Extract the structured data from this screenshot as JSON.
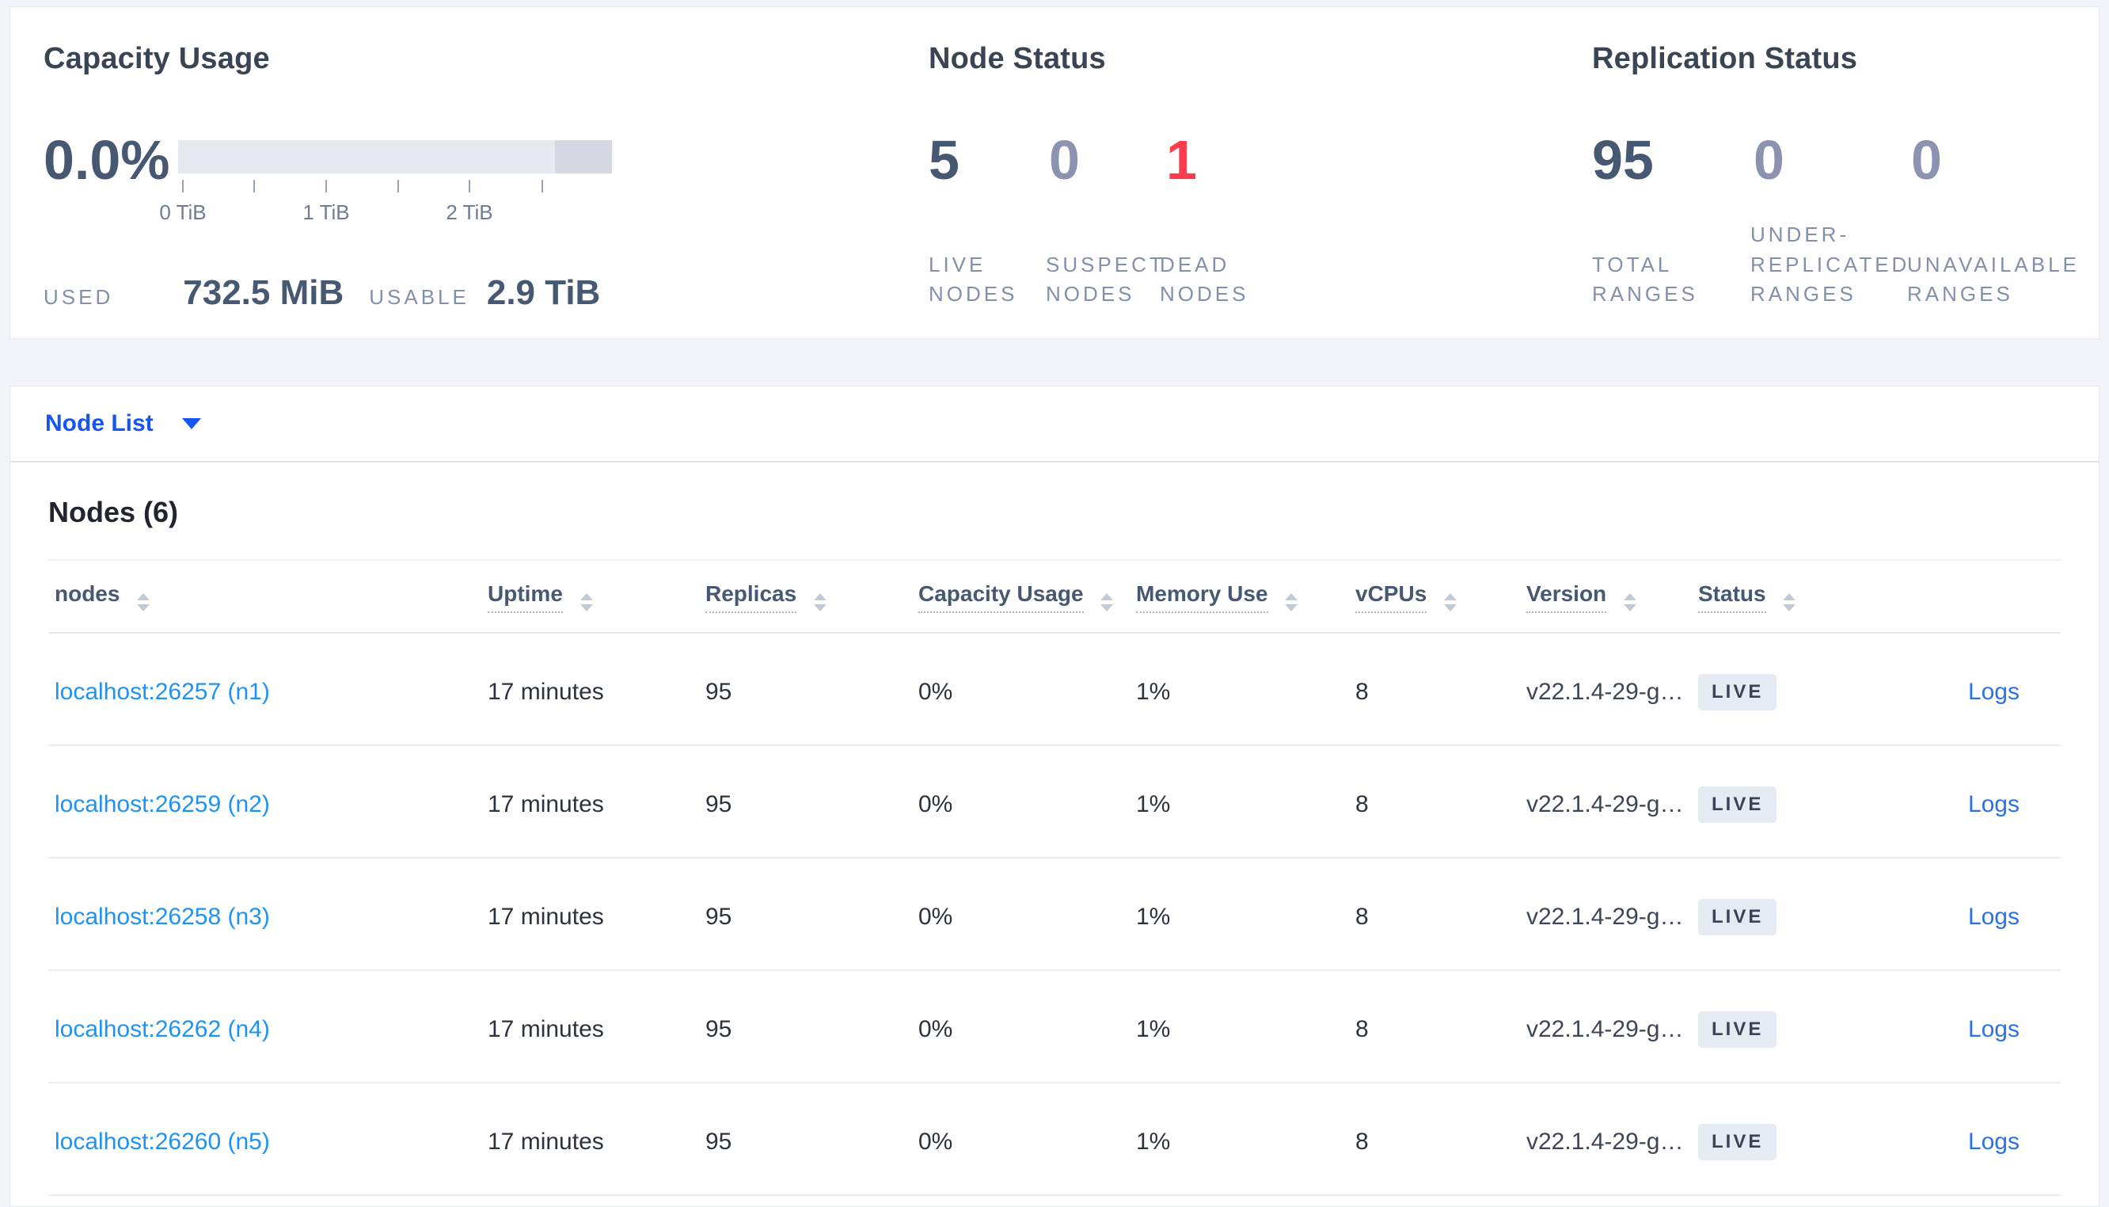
{
  "colors": {
    "accent_blue": "#1655f2",
    "node_link_blue": "#1e93f5",
    "logs_blue": "#2b72e8",
    "stat_dark": "#475872",
    "stat_muted": "#8b93b1",
    "stat_red": "#ff3c4d",
    "badge_bg": "#e6eaf2"
  },
  "summary": {
    "capacity": {
      "title": "Capacity Usage",
      "percent": "0.0%",
      "used_label": "USED",
      "used_value": "732.5 MiB",
      "usable_label": "USABLE",
      "usable_value": "2.9 TiB",
      "chart": {
        "type": "bar",
        "used_percent": 0.0,
        "used": "732.5 MiB",
        "usable": "2.9 TiB",
        "axis_ticks": [
          "0 TiB",
          "1 TiB",
          "2 TiB"
        ],
        "axis_range_tib": [
          0,
          3
        ]
      }
    },
    "node_status": {
      "title": "Node Status",
      "stats": [
        {
          "value": "5",
          "label": "LIVE NODES",
          "color": "#475872"
        },
        {
          "value": "0",
          "label": "SUSPECT NODES",
          "color": "#8b93b1"
        },
        {
          "value": "1",
          "label": "DEAD NODES",
          "color": "#ff3c4d"
        }
      ]
    },
    "replication_status": {
      "title": "Replication Status",
      "stats": [
        {
          "value": "95",
          "label": "TOTAL RANGES",
          "color": "#475872"
        },
        {
          "value": "0",
          "label": "UNDER-REPLICATED RANGES",
          "color": "#8b93b1"
        },
        {
          "value": "0",
          "label": "UNAVAILABLE RANGES",
          "color": "#8b93b1"
        }
      ]
    }
  },
  "view_selector": {
    "label": "Node List"
  },
  "nodes_section": {
    "heading": "Nodes (6)",
    "columns": [
      {
        "label": "nodes"
      },
      {
        "label": "Uptime"
      },
      {
        "label": "Replicas"
      },
      {
        "label": "Capacity Usage"
      },
      {
        "label": "Memory Use"
      },
      {
        "label": "vCPUs"
      },
      {
        "label": "Version"
      },
      {
        "label": "Status"
      }
    ],
    "rows": [
      {
        "node": "localhost:26257 (n1)",
        "uptime": "17 minutes",
        "replicas": "95",
        "capacity_usage": "0%",
        "memory_use": "1%",
        "vcpus": "8",
        "version": "v22.1.4-29-g…",
        "status": "LIVE",
        "logs": "Logs"
      },
      {
        "node": "localhost:26259 (n2)",
        "uptime": "17 minutes",
        "replicas": "95",
        "capacity_usage": "0%",
        "memory_use": "1%",
        "vcpus": "8",
        "version": "v22.1.4-29-g…",
        "status": "LIVE",
        "logs": "Logs"
      },
      {
        "node": "localhost:26258 (n3)",
        "uptime": "17 minutes",
        "replicas": "95",
        "capacity_usage": "0%",
        "memory_use": "1%",
        "vcpus": "8",
        "version": "v22.1.4-29-g…",
        "status": "LIVE",
        "logs": "Logs"
      },
      {
        "node": "localhost:26262 (n4)",
        "uptime": "17 minutes",
        "replicas": "95",
        "capacity_usage": "0%",
        "memory_use": "1%",
        "vcpus": "8",
        "version": "v22.1.4-29-g…",
        "status": "LIVE",
        "logs": "Logs"
      },
      {
        "node": "localhost:26260 (n5)",
        "uptime": "17 minutes",
        "replicas": "95",
        "capacity_usage": "0%",
        "memory_use": "1%",
        "vcpus": "8",
        "version": "v22.1.4-29-g…",
        "status": "LIVE",
        "logs": "Logs"
      }
    ]
  }
}
